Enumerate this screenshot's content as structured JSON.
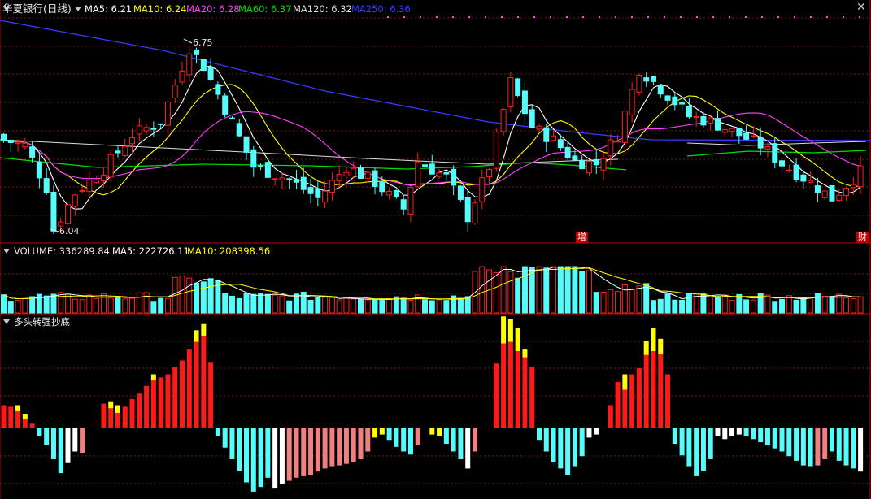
{
  "colors": {
    "up": "#ff2020",
    "down": "#54fcfc",
    "ma5": "#ffffff",
    "ma10": "#ffff00",
    "ma20": "#ff40ff",
    "ma60": "#00dd00",
    "ma120": "#dddddd",
    "ma250": "#3a3aff",
    "grid": "#7a1a1a",
    "separator": "#c00000",
    "ind_red": "#ff1a1a",
    "ind_yellow": "#ffff00",
    "ind_cyan": "#54fcfc",
    "ind_white": "#ffffff",
    "ind_pink": "#f08080"
  },
  "header": {
    "title": "华夏银行(日线)",
    "ma5": "MA5: 6.21",
    "ma10": "MA10: 6.24",
    "ma20": "MA20: 6.28",
    "ma60": "MA60: 6.37",
    "ma120": "MA120: 6.32",
    "ma250": "MA250: 6.36"
  },
  "volume_header": {
    "volume": "VOLUME: 336289.84",
    "ma5": "MA5: 222726.11",
    "ma10": "MA10: 208398.56"
  },
  "indicator_header": {
    "name": "多头转强抄底"
  },
  "annotations": {
    "high_label": "6.75",
    "low_label": "6.04",
    "event_zeng": "增",
    "event_cai": "财"
  },
  "icons": {
    "collapse": "triangle-down-icon",
    "settings": "cross-icon"
  },
  "chart_data": [
    {
      "type": "candlestick",
      "name": "price",
      "high": 6.75,
      "low": 6.04,
      "ma_latest": {
        "MA5": 6.21,
        "MA10": 6.24,
        "MA20": 6.28,
        "MA60": 6.37,
        "MA120": 6.32,
        "MA250": 6.36
      }
    },
    {
      "type": "bar",
      "name": "volume",
      "latest": {
        "VOLUME": 336289.84,
        "MA5": 222726.11,
        "MA10": 208398.56
      }
    },
    {
      "type": "bar",
      "name": "多头转强抄底"
    }
  ]
}
